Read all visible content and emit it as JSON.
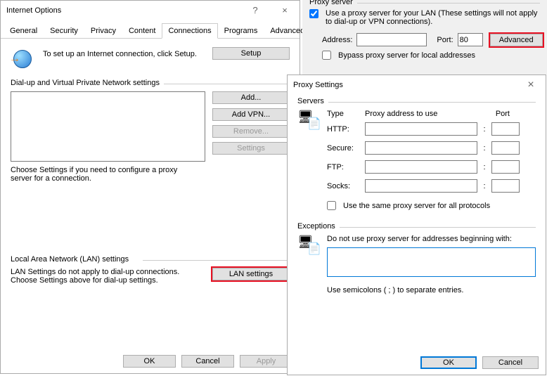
{
  "internetOptions": {
    "title": "Internet Options",
    "tabs": [
      "General",
      "Security",
      "Privacy",
      "Content",
      "Connections",
      "Programs",
      "Advanced"
    ],
    "activeTab": "Connections",
    "setupText": "To set up an Internet connection, click Setup.",
    "setupBtn": "Setup",
    "dialupHeader": "Dial-up and Virtual Private Network settings",
    "addBtn": "Add...",
    "addVpnBtn": "Add VPN...",
    "removeBtn": "Remove...",
    "settingsBtn": "Settings",
    "chooseSettings": "Choose Settings if you need to configure a proxy server for a connection.",
    "lanHeader": "Local Area Network (LAN) settings",
    "lanNote": "LAN Settings do not apply to dial-up connections. Choose Settings above for dial-up settings.",
    "lanBtn": "LAN settings",
    "ok": "OK",
    "cancel": "Cancel",
    "apply": "Apply"
  },
  "proxyServer": {
    "header": "Proxy server",
    "useProxy": "Use a proxy server for your LAN (These settings will not apply to dial-up or VPN connections).",
    "useProxyChecked": true,
    "addressLabel": "Address:",
    "addressValue": "",
    "portLabel": "Port:",
    "portValue": "80",
    "advancedBtn": "Advanced",
    "bypassLabel": "Bypass proxy server for local addresses",
    "bypassChecked": false
  },
  "proxySettings": {
    "title": "Proxy Settings",
    "serversHeader": "Servers",
    "typeLabel": "Type",
    "proxyAddrLabel": "Proxy address to use",
    "portLabel": "Port",
    "rows": [
      {
        "label": "HTTP:",
        "addr": "",
        "port": ""
      },
      {
        "label": "Secure:",
        "addr": "",
        "port": ""
      },
      {
        "label": "FTP:",
        "addr": "",
        "port": ""
      },
      {
        "label": "Socks:",
        "addr": "",
        "port": ""
      }
    ],
    "sameProxyLabel": "Use the same proxy server for all protocols",
    "sameProxyChecked": false,
    "exceptionsHeader": "Exceptions",
    "exceptionsNote": "Do not use proxy server for addresses beginning with:",
    "exceptionsValue": "",
    "semicolonNote": "Use semicolons ( ; ) to separate entries.",
    "ok": "OK",
    "cancel": "Cancel"
  }
}
